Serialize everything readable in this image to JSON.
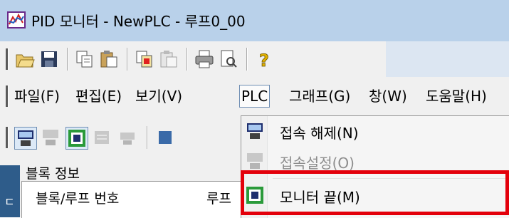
{
  "window": {
    "title": "PID 모니터 - NewPLC - 루프0_00"
  },
  "toolbar": {
    "buttons": [
      "open-icon",
      "save-icon",
      "copy-icon",
      "paste-icon",
      "copy-red-icon",
      "paste-disabled-icon",
      "print-icon",
      "print-preview-icon",
      "help-icon"
    ]
  },
  "menubar": {
    "items": [
      {
        "label": "파일(F)",
        "name": "menu-file"
      },
      {
        "label": "편집(E)",
        "name": "menu-edit"
      },
      {
        "label": "보기(V)",
        "name": "menu-view"
      },
      {
        "label": "PLC",
        "name": "menu-plc"
      },
      {
        "label": "그래프(G)",
        "name": "menu-graph"
      },
      {
        "label": "창(W)",
        "name": "menu-window"
      },
      {
        "label": "도움말(H)",
        "name": "menu-help"
      }
    ]
  },
  "plc_menu": {
    "items": [
      {
        "label": "접속 해제(N)",
        "enabled": true,
        "icon": "disconnect-icon"
      },
      {
        "label": "접속설정(O)",
        "enabled": false,
        "icon": "connection-settings-icon"
      },
      {
        "label": "모니터 끝(M)",
        "enabled": true,
        "icon": "monitor-end-icon",
        "highlighted": true
      }
    ]
  },
  "panel": {
    "title": "블록 정보",
    "columns": [
      "블록/루프 번호",
      "루프"
    ]
  },
  "colors": {
    "title_bar": "#b9d1ea",
    "highlight": "#e3000b"
  }
}
